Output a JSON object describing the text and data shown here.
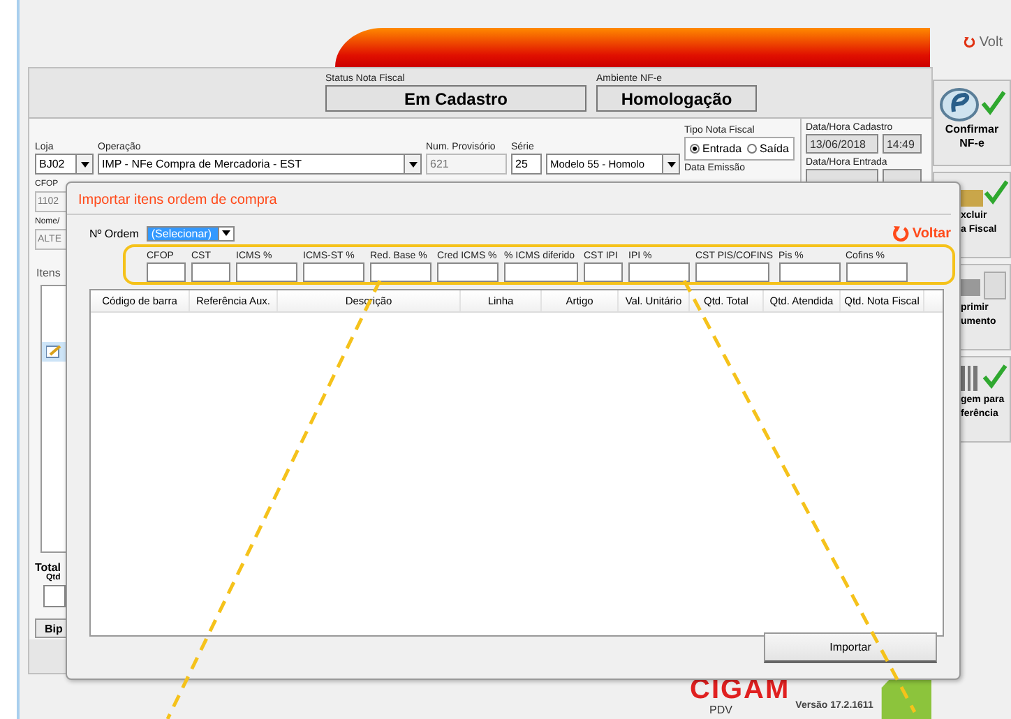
{
  "header": {
    "back_label": "Volt"
  },
  "status": [
    {
      "label": "Status Nota Fiscal",
      "value": "Em Cadastro"
    },
    {
      "label": "Ambiente NF-e",
      "value": "Homologação"
    }
  ],
  "form": {
    "loja": {
      "label": "Loja",
      "value": "BJ02"
    },
    "operacao": {
      "label": "Operação",
      "value": "IMP - NFe Compra de Mercadoria - EST"
    },
    "num_provisorio": {
      "label": "Num. Provisório",
      "value": "621"
    },
    "serie": {
      "label": "Série",
      "value": "25"
    },
    "modelo": {
      "value": "Modelo 55 - Homolo"
    },
    "tipo_nota": {
      "label": "Tipo Nota Fiscal",
      "options": [
        {
          "label": "Entrada",
          "selected": true
        },
        {
          "label": "Saída",
          "selected": false
        }
      ]
    },
    "data_cadastro": {
      "label": "Data/Hora Cadastro",
      "date": "13/06/2018",
      "time": "14:49"
    },
    "data_entrada": {
      "label": "Data/Hora Entrada"
    },
    "cfop": {
      "label": "CFOP",
      "value": "1102"
    },
    "nome": {
      "label": "Nome/",
      "value": "ALTE"
    },
    "data_emissao": {
      "label": "Data Emissão"
    }
  },
  "items_panel": {
    "tab": "Itens",
    "total_label": "Total",
    "qtd_label": "Qtd",
    "bip_button": "Bip"
  },
  "side_buttons": [
    {
      "kind": "nfe",
      "lines": [
        "Confirmar",
        "NF-e"
      ]
    },
    {
      "kind": "delete",
      "lines": [
        "xcluir",
        "a Fiscal"
      ]
    },
    {
      "kind": "print",
      "lines": [
        "primir",
        "umento"
      ]
    },
    {
      "kind": "label",
      "lines": [
        "gem para",
        "ferência"
      ]
    }
  ],
  "dialog": {
    "title": "Importar itens ordem de compra",
    "order_label": "Nº Ordem",
    "order_value": "(Selecionar)",
    "back_button": "Voltar",
    "fields": [
      "CFOP",
      "CST",
      "ICMS %",
      "ICMS-ST %",
      "Red. Base %",
      "Cred ICMS %",
      "% ICMS diferido",
      "CST IPI",
      "IPI %",
      "CST PIS/COFINS",
      "Pis %",
      "Cofins %"
    ],
    "columns": [
      "Código de barra",
      "Referência Aux.",
      "Descrição",
      "Linha",
      "Artigo",
      "Val. Unitário",
      "Qtd. Total",
      "Qtd. Atendida",
      "Qtd. Nota Fiscal"
    ],
    "import_button": "Importar"
  },
  "footer": {
    "logo": "CIGAM",
    "product": "PDV",
    "version": "Versão 17.2.1611"
  }
}
